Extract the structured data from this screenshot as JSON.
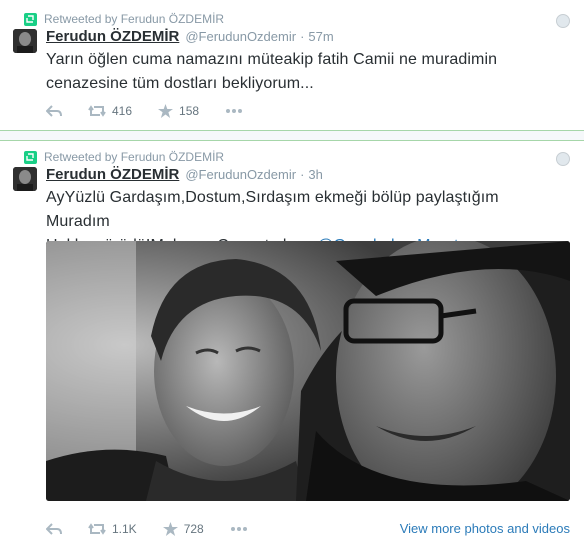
{
  "tweets": [
    {
      "retweeted_by": "Retweeted by Ferudun ÖZDEMİR",
      "name": "Ferudun ÖZDEMİR",
      "handle": "@FerudunOzdemir",
      "separator": "·",
      "time": "57m",
      "text": "Yarın öğlen cuma namazını müteakip fatih Camii ne  muradimin cenazesine tüm dostları bekliyorum...",
      "retweets": "416",
      "favorites": "158"
    },
    {
      "retweeted_by": "Retweeted by Ferudun ÖZDEMİR",
      "name": "Ferudun ÖZDEMİR",
      "handle": "@FerudunOzdemir",
      "separator": "·",
      "time": "3h",
      "text_line1": "AyYüzlü Gardaşım,Dostum,Sırdaşım ekmeği bölüp paylaştığım Muradım",
      "text_line2": "Hakka yürüdü!Mekanın Cennet olsun ",
      "mention": "@GogebakanMurat",
      "retweets": "1.1K",
      "favorites": "728",
      "view_more": "View more photos and videos"
    }
  ],
  "icons": {
    "retweet_badge": "retweet-icon",
    "reply": "reply-icon",
    "retweet": "retweet-icon",
    "favorite": "star-icon",
    "more": "more-icon",
    "globe": "globe-icon"
  },
  "colors": {
    "retweet_green": "#19cf86",
    "link_blue": "#2b7bb9",
    "meta_gray": "#8899a6",
    "divider_green": "#a6d6a9"
  }
}
